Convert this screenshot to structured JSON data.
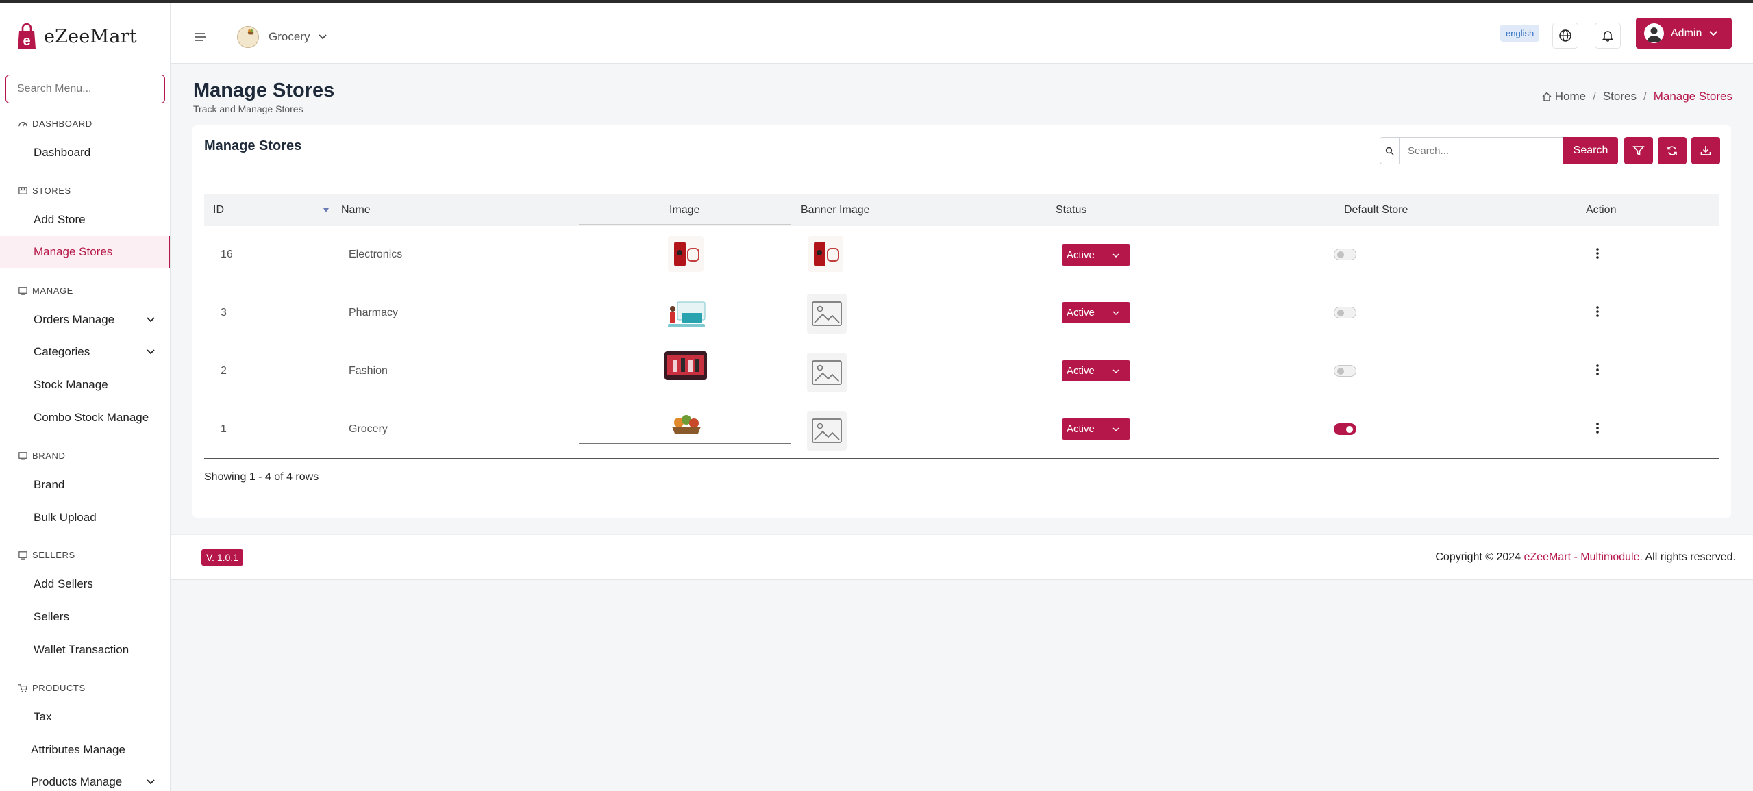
{
  "sidebar": {
    "logo_text": "eZeeMart",
    "search_placeholder": "Search Menu...",
    "sections": {
      "dashboard": "DASHBOARD",
      "stores": "STORES",
      "manage": "MANAGE",
      "brand": "BRAND",
      "sellers": "SELLERS",
      "products": "PRODUCTS"
    },
    "items": {
      "dashboard": "Dashboard",
      "add_store": "Add Store",
      "manage_stores": "Manage Stores",
      "orders_manage": "Orders Manage",
      "categories": "Categories",
      "stock_manage": "Stock Manage",
      "combo_stock_manage": "Combo Stock Manage",
      "brand": "Brand",
      "bulk_upload": "Bulk Upload",
      "add_sellers": "Add Sellers",
      "sellers": "Sellers",
      "wallet_transaction": "Wallet Transaction",
      "tax": "Tax",
      "attributes_manage": "Attributes Manage",
      "products_manage": "Products Manage"
    }
  },
  "header": {
    "store_selector": "Grocery",
    "language_badge": "english",
    "admin_label": "Admin"
  },
  "page": {
    "title": "Manage Stores",
    "subtitle": "Track and Manage Stores",
    "breadcrumb": [
      "Home",
      "Stores",
      "Manage Stores"
    ]
  },
  "card": {
    "title": "Manage Stores",
    "search_placeholder": "Search...",
    "search_button": "Search",
    "columns": [
      "ID",
      "Name",
      "Image",
      "Banner Image",
      "Status",
      "Default Store",
      "Action"
    ],
    "rows": [
      {
        "id": "16",
        "name": "Electronics",
        "status": "Active",
        "default": false
      },
      {
        "id": "3",
        "name": "Pharmacy",
        "status": "Active",
        "default": false
      },
      {
        "id": "2",
        "name": "Fashion",
        "status": "Active",
        "default": false
      },
      {
        "id": "1",
        "name": "Grocery",
        "status": "Active",
        "default": true
      }
    ],
    "showing_text": "Showing 1 - 4 of 4 rows"
  },
  "footer": {
    "version": "V. 1.0.1",
    "copyright_prefix": "Copyright © 2024 ",
    "brand": "eZeeMart - Multimodule.",
    "copyright_suffix": " All rights reserved."
  },
  "colors": {
    "accent": "#b5174a",
    "background": "#f4f6f7"
  }
}
